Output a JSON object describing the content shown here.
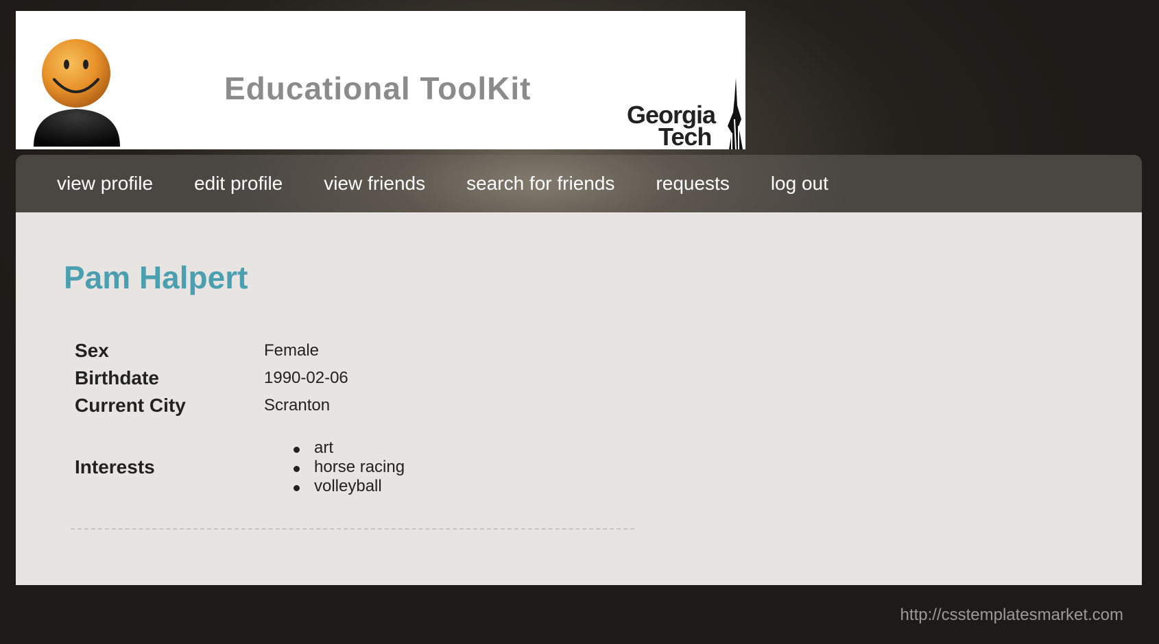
{
  "banner": {
    "title": "Educational ToolKit",
    "logo_line1": "Georgia",
    "logo_line2": "Tech",
    "mascot_icon": "smiley-icon"
  },
  "nav": {
    "items": [
      {
        "label": "view profile",
        "active": true
      },
      {
        "label": "edit profile"
      },
      {
        "label": "view friends"
      },
      {
        "label": "search for friends"
      },
      {
        "label": "requests"
      },
      {
        "label": "log out"
      }
    ]
  },
  "profile": {
    "name": "Pam Halpert",
    "fields": [
      {
        "label": "Sex",
        "value": "Female"
      },
      {
        "label": "Birthdate",
        "value": "1990-02-06"
      },
      {
        "label": "Current City",
        "value": "Scranton"
      }
    ],
    "interests_label": "Interests",
    "interests": [
      "art",
      "horse racing",
      "volleyball"
    ]
  },
  "footer": {
    "link": "http://csstemplatesmarket.com"
  },
  "colors": {
    "name": "#4a9fb0",
    "content_bg": "#e8e4e1",
    "nav_text": "#ffffff"
  }
}
